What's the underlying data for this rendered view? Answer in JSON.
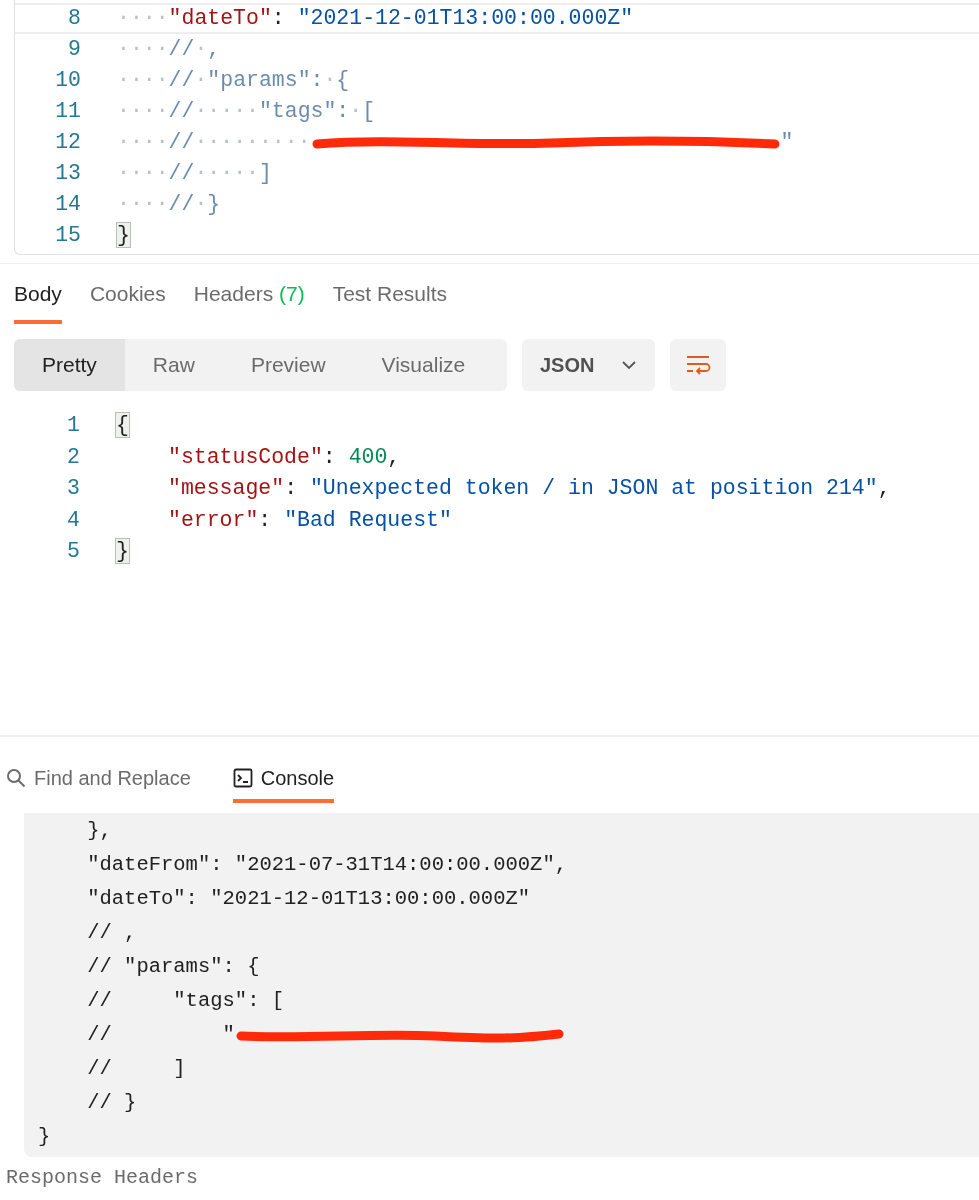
{
  "request_editor": {
    "lines": [
      {
        "number": "8",
        "highlighted": true,
        "tokens": [
          {
            "kind": "ws",
            "text": "····"
          },
          {
            "kind": "key",
            "text": "\"dateTo\""
          },
          {
            "kind": "punct",
            "text": ": "
          },
          {
            "kind": "string",
            "text": "\"2021-12-01T13:00:00.000Z\""
          }
        ]
      },
      {
        "number": "9",
        "highlighted": false,
        "tokens": [
          {
            "kind": "ws",
            "text": "····"
          },
          {
            "kind": "comment",
            "text": "//"
          },
          {
            "kind": "ws",
            "text": "·"
          },
          {
            "kind": "comment",
            "text": ","
          }
        ]
      },
      {
        "number": "10",
        "highlighted": false,
        "tokens": [
          {
            "kind": "ws",
            "text": "····"
          },
          {
            "kind": "comment",
            "text": "//"
          },
          {
            "kind": "ws",
            "text": "·"
          },
          {
            "kind": "comment",
            "text": "\"params\":"
          },
          {
            "kind": "ws",
            "text": "·"
          },
          {
            "kind": "comment",
            "text": "{"
          }
        ]
      },
      {
        "number": "11",
        "highlighted": false,
        "tokens": [
          {
            "kind": "ws",
            "text": "····"
          },
          {
            "kind": "comment",
            "text": "//"
          },
          {
            "kind": "ws",
            "text": "·····"
          },
          {
            "kind": "comment",
            "text": "\"tags\":"
          },
          {
            "kind": "ws",
            "text": "·"
          },
          {
            "kind": "comment",
            "text": "["
          }
        ]
      },
      {
        "number": "12",
        "highlighted": false,
        "tokens": [
          {
            "kind": "ws",
            "text": "····"
          },
          {
            "kind": "comment",
            "text": "//"
          },
          {
            "kind": "ws",
            "text": "·········"
          },
          {
            "kind": "redacted"
          },
          {
            "kind": "comment",
            "text": "\""
          }
        ]
      },
      {
        "number": "13",
        "highlighted": false,
        "tokens": [
          {
            "kind": "ws",
            "text": "····"
          },
          {
            "kind": "comment",
            "text": "//"
          },
          {
            "kind": "ws",
            "text": "·····"
          },
          {
            "kind": "comment",
            "text": "]"
          }
        ]
      },
      {
        "number": "14",
        "highlighted": false,
        "tokens": [
          {
            "kind": "ws",
            "text": "····"
          },
          {
            "kind": "comment",
            "text": "//"
          },
          {
            "kind": "ws",
            "text": "·"
          },
          {
            "kind": "comment",
            "text": "}"
          }
        ]
      },
      {
        "number": "15",
        "highlighted": false,
        "tokens": [
          {
            "kind": "brace_match",
            "text": "}"
          }
        ]
      }
    ]
  },
  "response_tabs": [
    {
      "label": "Body",
      "selected": true
    },
    {
      "label": "Cookies",
      "selected": false
    },
    {
      "label": "Headers",
      "count": "(7)",
      "selected": false
    },
    {
      "label": "Test Results",
      "selected": false
    }
  ],
  "view_modes": [
    {
      "label": "Pretty",
      "selected": true
    },
    {
      "label": "Raw",
      "selected": false
    },
    {
      "label": "Preview",
      "selected": false
    },
    {
      "label": "Visualize",
      "selected": false
    }
  ],
  "format_select": {
    "value": "JSON"
  },
  "response_body": {
    "lines": [
      {
        "number": "1",
        "indented": false,
        "tokens": [
          {
            "kind": "brace_match",
            "text": "{"
          }
        ]
      },
      {
        "number": "2",
        "indented": true,
        "tokens": [
          {
            "kind": "key",
            "text": "\"statusCode\""
          },
          {
            "kind": "punct",
            "text": ": "
          },
          {
            "kind": "number",
            "text": "400"
          },
          {
            "kind": "punct",
            "text": ","
          }
        ]
      },
      {
        "number": "3",
        "indented": true,
        "tokens": [
          {
            "kind": "key",
            "text": "\"message\""
          },
          {
            "kind": "punct",
            "text": ": "
          },
          {
            "kind": "string",
            "text": "\"Unexpected token / in JSON at position 214\""
          },
          {
            "kind": "punct",
            "text": ","
          }
        ]
      },
      {
        "number": "4",
        "indented": true,
        "tokens": [
          {
            "kind": "key",
            "text": "\"error\""
          },
          {
            "kind": "punct",
            "text": ": "
          },
          {
            "kind": "string",
            "text": "\"Bad Request\""
          }
        ]
      },
      {
        "number": "5",
        "indented": false,
        "tokens": [
          {
            "kind": "brace_match",
            "text": "}"
          }
        ]
      }
    ]
  },
  "bottom_tabs": [
    {
      "label": "Find and Replace",
      "kind": "search",
      "selected": false
    },
    {
      "label": "Console",
      "kind": "terminal",
      "selected": true
    }
  ],
  "console": {
    "lines": [
      {
        "text": "    },",
        "redacted": false
      },
      {
        "text": "    \"dateFrom\": \"2021-07-31T14:00:00.000Z\",",
        "redacted": false
      },
      {
        "text": "    \"dateTo\": \"2021-12-01T13:00:00.000Z\"",
        "redacted": false
      },
      {
        "text": "    // ,",
        "redacted": false
      },
      {
        "text": "    // \"params\": {",
        "redacted": false
      },
      {
        "text": "    //     \"tags\": [",
        "redacted": false
      },
      {
        "text": "    //         \"",
        "redacted": true
      },
      {
        "text": "    //     ]",
        "redacted": false
      },
      {
        "text": "    // }",
        "redacted": false
      },
      {
        "text": "}",
        "redacted": false
      }
    ]
  },
  "response_headers_label": "Response Headers"
}
